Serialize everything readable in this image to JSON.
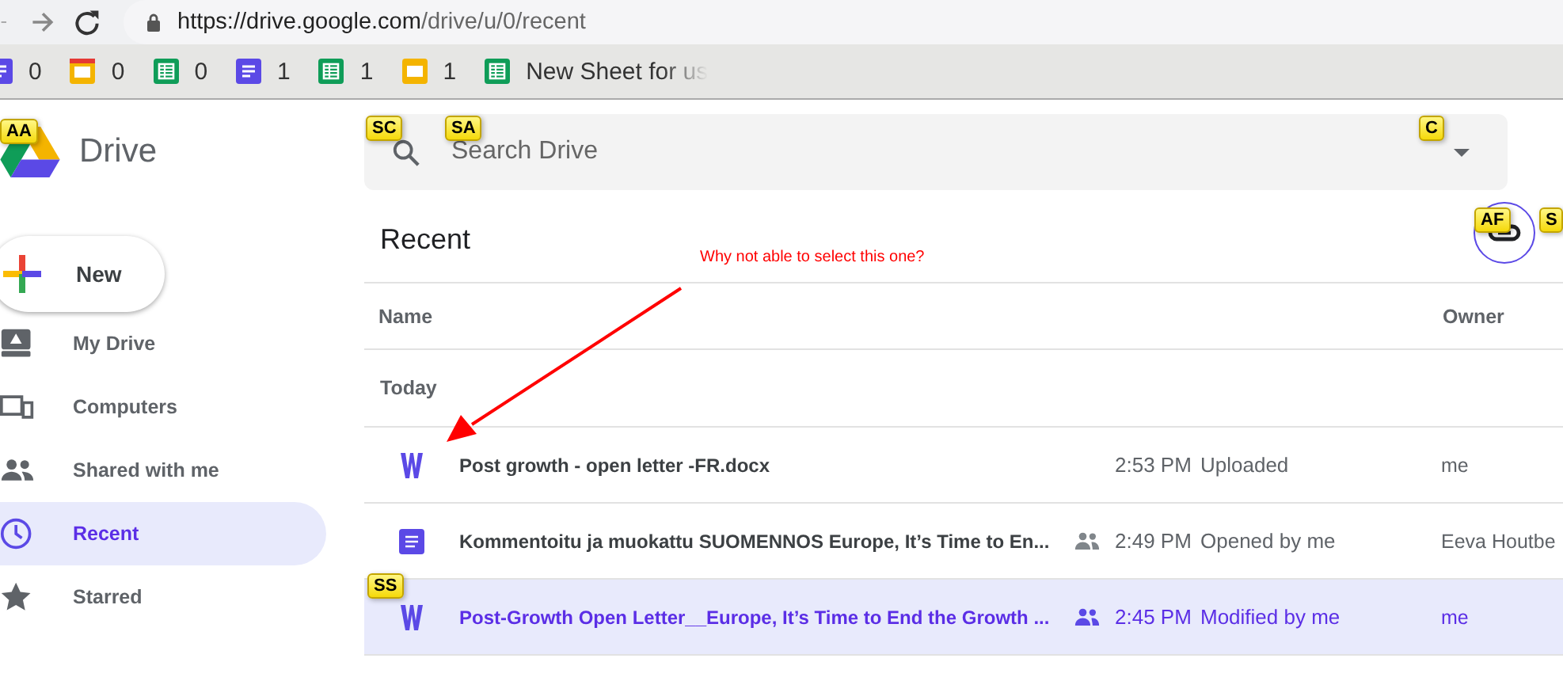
{
  "browser": {
    "url_host": "https://drive.google.com",
    "url_path": "/drive/u/0/recent"
  },
  "bookmarks": [
    {
      "kind": "docs",
      "label": "0"
    },
    {
      "kind": "slides_red",
      "label": "0"
    },
    {
      "kind": "sheets",
      "label": "0"
    },
    {
      "kind": "docs",
      "label": "1"
    },
    {
      "kind": "sheets",
      "label": "1"
    },
    {
      "kind": "slides",
      "label": "1"
    },
    {
      "kind": "sheets",
      "label": "New Sheet for us"
    }
  ],
  "app": {
    "name": "Drive"
  },
  "search": {
    "placeholder": "Search Drive"
  },
  "new_button": "New",
  "sidebar": {
    "items": [
      {
        "label": "My Drive",
        "selected": false
      },
      {
        "label": "Computers",
        "selected": false
      },
      {
        "label": "Shared with me",
        "selected": false
      },
      {
        "label": "Recent",
        "selected": true
      },
      {
        "label": "Starred",
        "selected": false
      }
    ]
  },
  "page_title": "Recent",
  "table": {
    "columns": [
      "Name",
      "Owner"
    ],
    "group": "Today",
    "rows": [
      {
        "kind": "word",
        "name": "Post growth - open letter -FR.docx",
        "shared": false,
        "time": "2:53 PM",
        "activity": "Uploaded",
        "owner": "me",
        "selected": false
      },
      {
        "kind": "doc",
        "name": "Kommentoitu ja muokattu SUOMENNOS Europe, It’s Time to En...",
        "shared": true,
        "time": "2:49 PM",
        "activity": "Opened by me",
        "owner": "Eeva Houtbe",
        "selected": false
      },
      {
        "kind": "word",
        "name": "Post-Growth Open Letter__Europe, It’s Time to End the Growth ...",
        "shared": true,
        "time": "2:45 PM",
        "activity": "Modified by me",
        "owner": "me",
        "selected": true
      }
    ]
  },
  "annotation": {
    "text": "Why not able to select this one?"
  },
  "hints": [
    {
      "label": "AA"
    },
    {
      "label": "SC"
    },
    {
      "label": "SA"
    },
    {
      "label": "C"
    },
    {
      "label": "AF"
    },
    {
      "label": "S"
    },
    {
      "label": "SS"
    }
  ]
}
